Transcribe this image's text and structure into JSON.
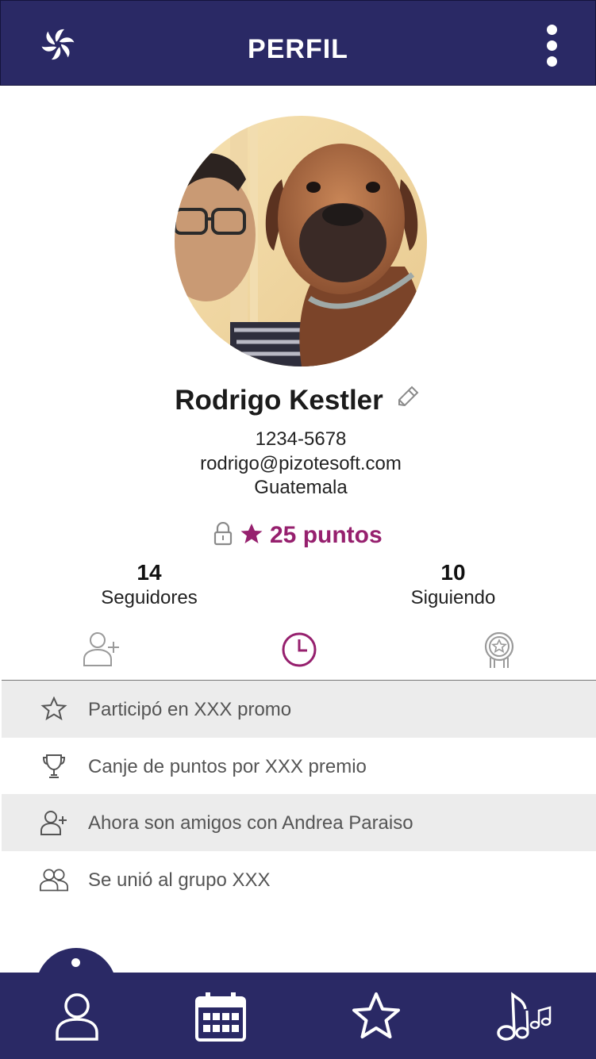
{
  "header": {
    "title": "PERFIL"
  },
  "profile": {
    "name": "Rodrigo Kestler",
    "phone": "1234-5678",
    "email": "rodrigo@pizotesoft.com",
    "country": "Guatemala",
    "points": "25 puntos"
  },
  "stats": {
    "followers": {
      "count": "14",
      "label": "Seguidores"
    },
    "following": {
      "count": "10",
      "label": "Siguiendo"
    }
  },
  "activity": [
    {
      "icon": "star-icon",
      "text": "Participó en XXX promo"
    },
    {
      "icon": "trophy-icon",
      "text": "Canje de puntos por XXX premio"
    },
    {
      "icon": "add-friend-icon",
      "text": "Ahora son amigos con Andrea Paraiso"
    },
    {
      "icon": "group-icon",
      "text": "Se unió al grupo XXX"
    }
  ],
  "colors": {
    "brand": "#2a2965",
    "accent": "#96206e",
    "row_gray": "#ececec"
  },
  "bottom_nav": [
    "profile-icon",
    "calendar-icon",
    "star-icon",
    "music-icon"
  ]
}
